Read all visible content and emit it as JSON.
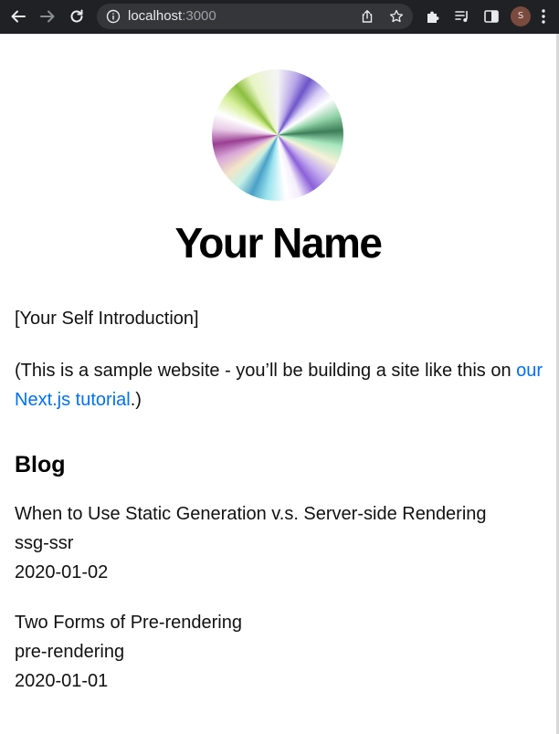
{
  "browser": {
    "url_host": "localhost",
    "url_port": ":3000",
    "profile_initial": "S",
    "icons": [
      "back-arrow-icon",
      "forward-arrow-icon",
      "reload-icon",
      "info-icon",
      "share-icon",
      "star-icon",
      "extensions-icon",
      "media-control-icon",
      "side-panel-icon",
      "kebab-menu-icon"
    ]
  },
  "colors": {
    "chrome_bg": "#202124",
    "omnibox_bg": "#35363a",
    "link": "#0070f3",
    "text": "#111111"
  },
  "profile": {
    "name": "Your Name"
  },
  "intro": {
    "self_intro": "[Your Self Introduction]",
    "sample_prefix": "(This is a sample website - you’ll be building a site like this on ",
    "tutorial_link": "our Next.js tutorial",
    "sample_suffix": ".)"
  },
  "blog": {
    "heading": "Blog",
    "posts": [
      {
        "title": "When to Use Static Generation v.s. Server-side Rendering",
        "id": "ssg-ssr",
        "date": "2020-01-02"
      },
      {
        "title": "Two Forms of Pre-rendering",
        "id": "pre-rendering",
        "date": "2020-01-01"
      }
    ]
  }
}
